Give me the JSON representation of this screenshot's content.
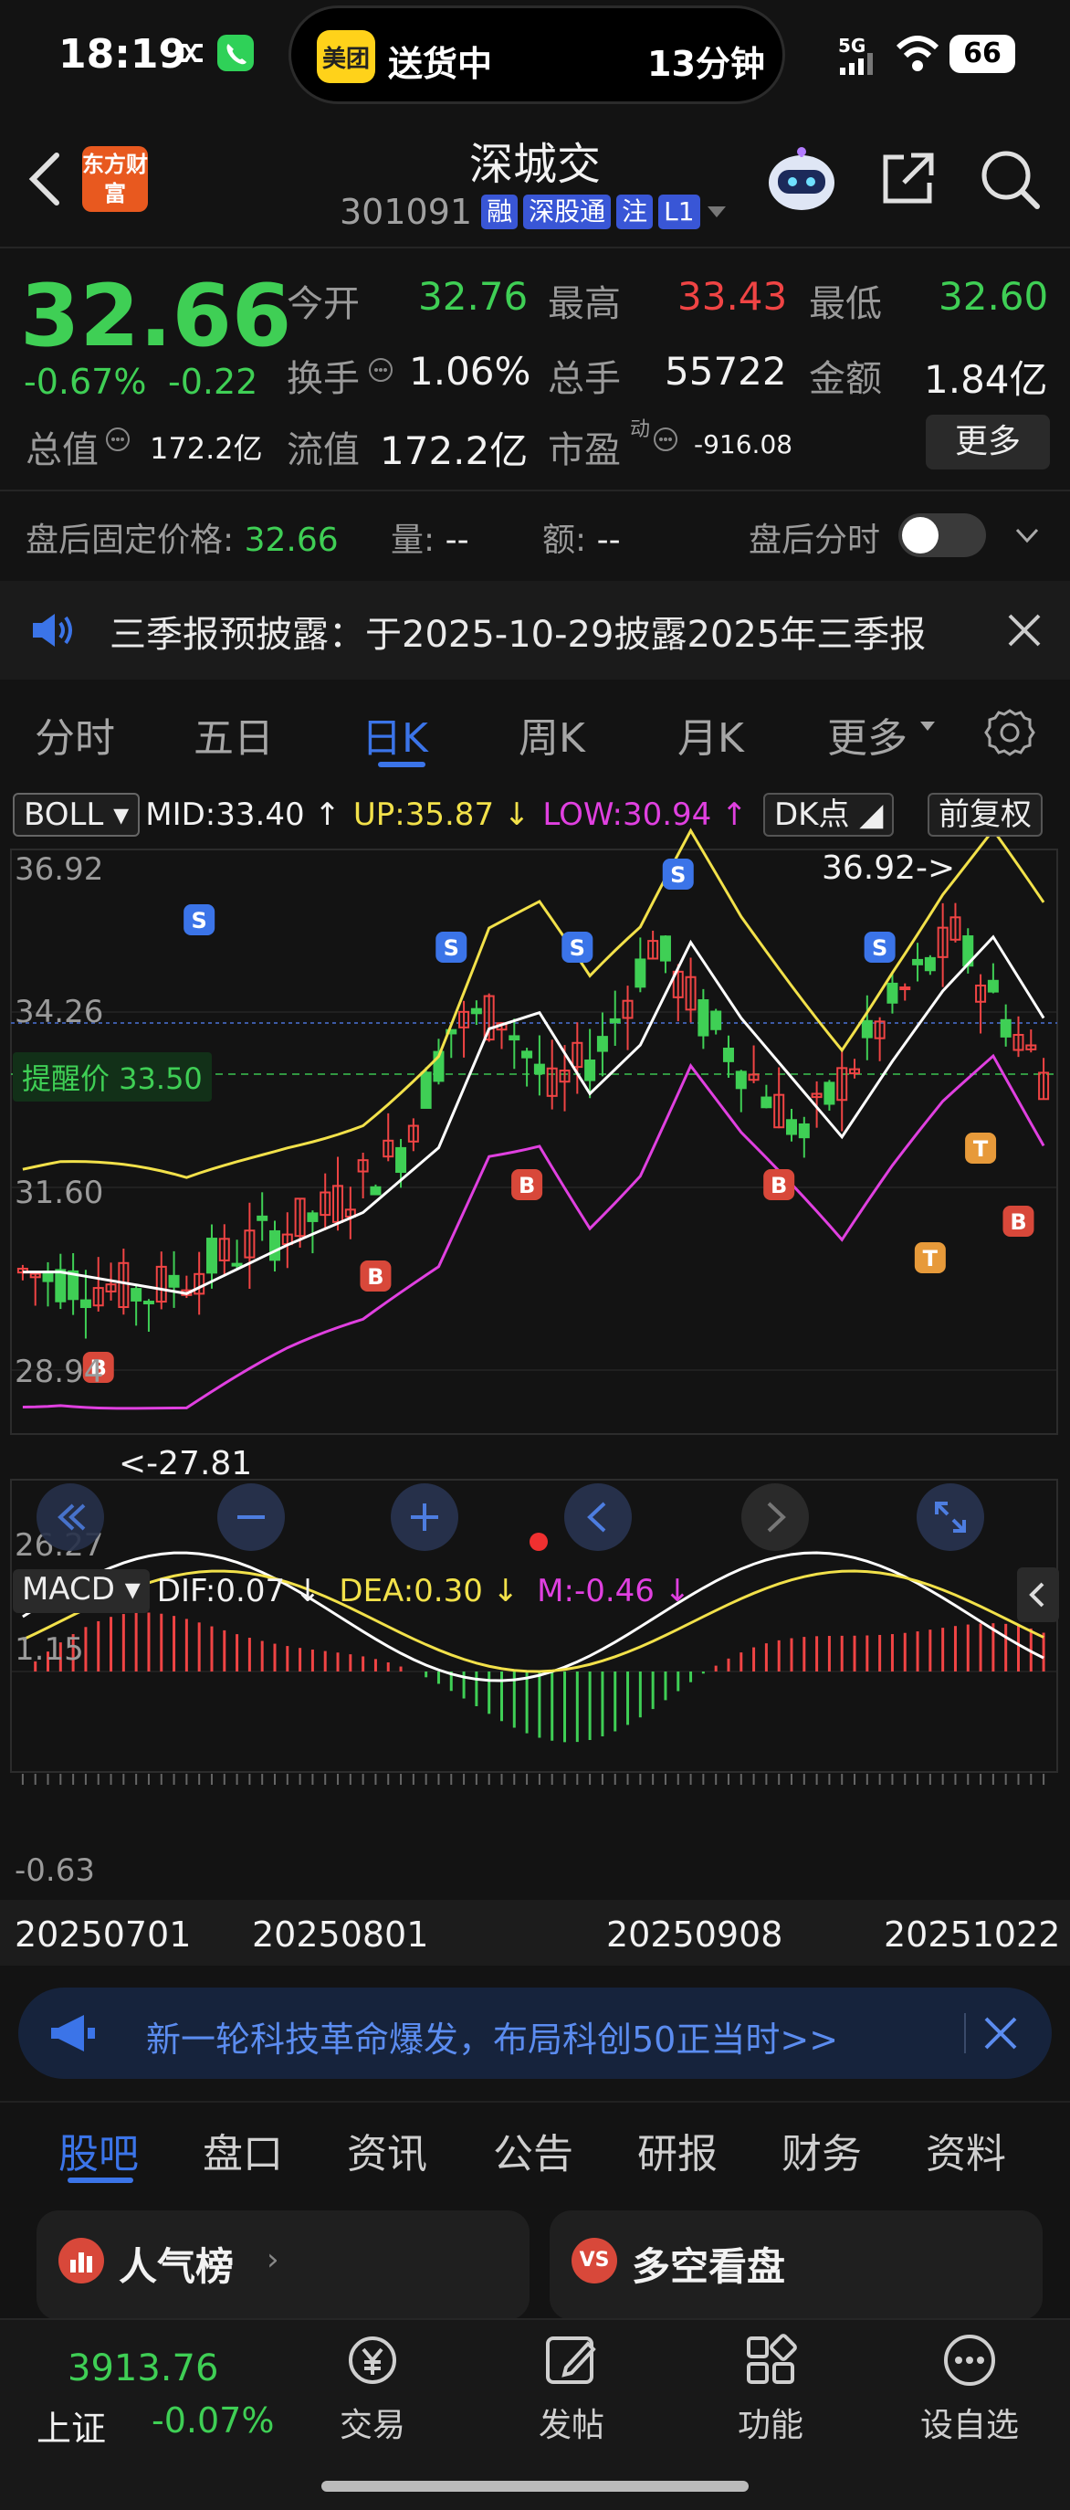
{
  "status_bar": {
    "time": "18:19",
    "live_activity": {
      "app_logo": "美团",
      "label": "送货中",
      "eta": "13分钟"
    },
    "network": "5G",
    "battery": "66"
  },
  "header": {
    "brand_logo": "东方财富",
    "name": "深城交",
    "code": "301091",
    "tags": [
      "融",
      "深股通",
      "注",
      "L1"
    ]
  },
  "quote": {
    "price": "32.66",
    "change_pct": "-0.67%",
    "change": "-0.22",
    "open_label": "今开",
    "open": "32.76",
    "high_label": "最高",
    "high": "33.43",
    "low_label": "最低",
    "low": "32.60",
    "turnover_label": "换手",
    "turnover": "1.06%",
    "volume_label": "总手",
    "volume": "55722",
    "amount_label": "金额",
    "amount": "1.84亿",
    "mktcap_label": "总值",
    "mktcap": "172.2亿",
    "float_label": "流值",
    "float": "172.2亿",
    "pe_label": "市盈",
    "pe_sup": "动",
    "pe": "-916.08",
    "more_label": "更多"
  },
  "after_hours": {
    "price_label": "盘后固定价格:",
    "price": "32.66",
    "vol_label": "量:",
    "vol": "--",
    "amt_label": "额:",
    "amt": "--",
    "toggle_label": "盘后分时"
  },
  "announcement": {
    "text": "三季报预披露：于2025-10-29披露2025年三季报"
  },
  "chart_tabs": [
    "分时",
    "五日",
    "日K",
    "周K",
    "月K",
    "更多"
  ],
  "active_tab": "日K",
  "boll": {
    "label": "BOLL",
    "mid": "MID:33.40 ↑",
    "up": "UP:35.87 ↓",
    "low": "LOW:30.94 ↑",
    "dk_label": "DK点",
    "adj_label": "前复权",
    "axis_labels": [
      "36.92",
      "34.26",
      "31.60",
      "28.94",
      "26.27"
    ],
    "alert_label": "提醒价 33.50",
    "max_label": "36.92->",
    "min_label": "<-27.81"
  },
  "macd": {
    "label": "MACD",
    "dif": "DIF:0.07 ↓",
    "dea": "DEA:0.30 ↓",
    "m": "M:-0.46 ↓",
    "axis_labels": [
      "1.15",
      "-0.63"
    ]
  },
  "dates": [
    "20250701",
    "20250801",
    "20250908",
    "20251022"
  ],
  "ad_banner": {
    "text": "新一轮科技革命爆发，布局科创50正当时>>"
  },
  "bottom_tabs": [
    "股吧",
    "盘口",
    "资讯",
    "公告",
    "研报",
    "财务",
    "资料"
  ],
  "active_bottom_tab": "股吧",
  "cards": [
    {
      "title": "人气榜"
    },
    {
      "title": "多空看盘"
    }
  ],
  "bottom_nav": {
    "index_value": "3913.76",
    "index_name": "上证",
    "index_change": "-0.07%",
    "items": [
      "交易",
      "发帖",
      "功能",
      "设自选"
    ]
  },
  "colors": {
    "up": "#f04444",
    "down": "#3fcf55",
    "accent": "#3b74e8",
    "boll_up": "#f2e14a",
    "boll_low": "#e040e0"
  }
}
